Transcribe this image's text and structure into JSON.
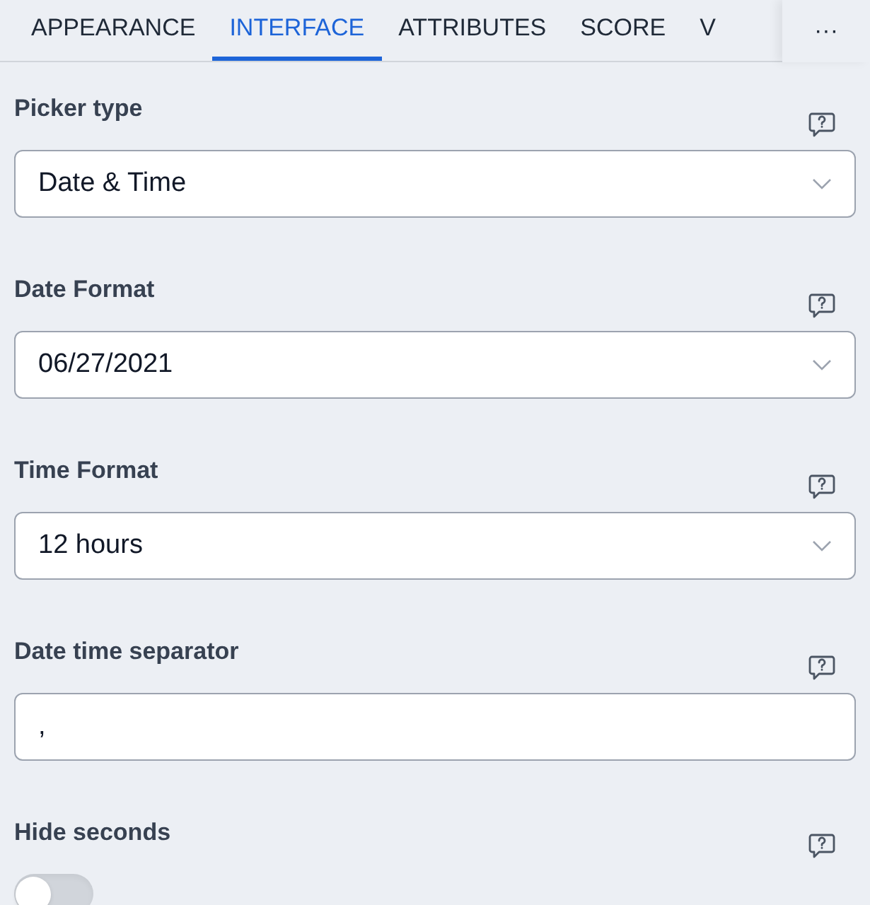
{
  "tabs": [
    {
      "label": "APPEARANCE",
      "selected": false
    },
    {
      "label": "INTERFACE",
      "selected": true
    },
    {
      "label": "ATTRIBUTES",
      "selected": false
    },
    {
      "label": "SCORE",
      "selected": false
    },
    {
      "label": "V",
      "selected": false
    }
  ],
  "more_button": "···",
  "fields": [
    {
      "kind": "select",
      "label": "Picker type",
      "value": "Date & Time"
    },
    {
      "kind": "select",
      "label": "Date Format",
      "value": "06/27/2021"
    },
    {
      "kind": "select",
      "label": "Time Format",
      "value": "12 hours"
    },
    {
      "kind": "text",
      "label": "Date time separator",
      "value": ","
    },
    {
      "kind": "toggle",
      "label": "Hide seconds",
      "on": false
    }
  ]
}
